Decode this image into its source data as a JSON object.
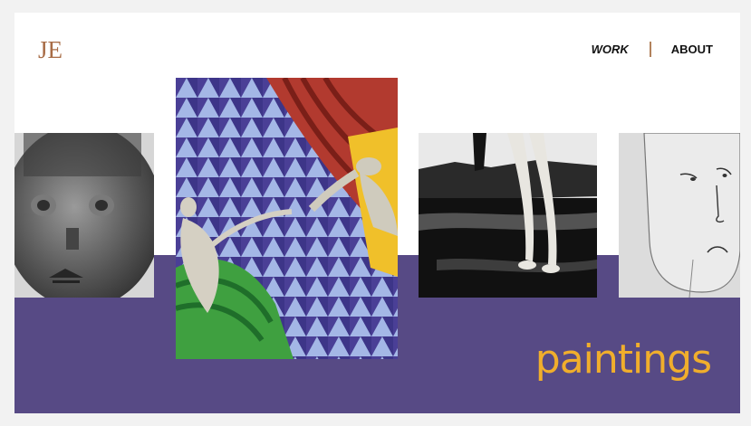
{
  "brand": {
    "logo_text": "JE"
  },
  "nav": {
    "items": [
      {
        "label": "WORK"
      },
      {
        "label": "ABOUT"
      }
    ]
  },
  "hero": {
    "section_title": "paintings"
  },
  "gallery": {
    "artworks": [
      {
        "subject": "metal mask face"
      },
      {
        "subject": "two figures reaching, triangle pattern"
      },
      {
        "subject": "legs by water, black and white"
      },
      {
        "subject": "sketched frowning face"
      }
    ]
  },
  "colors": {
    "background": "#ffffff",
    "band": "#574a85",
    "accent": "#f0ae2c",
    "logo": "#a86c46",
    "separator": "#b2825c"
  }
}
